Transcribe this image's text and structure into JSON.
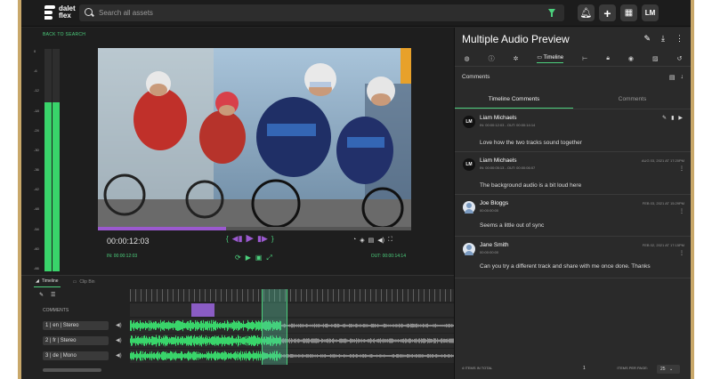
{
  "app": {
    "logo_text": "dalet flex",
    "search_placeholder": "Search all assets",
    "user_initials": "LM"
  },
  "player": {
    "back_label": "BACK TO SEARCH",
    "current_time": "00:00:12:03",
    "in_point": "IN: 00:00:12:03",
    "out_point": "OUT: 00:00:14:14",
    "progress_fraction": 0.41,
    "vu_scale": [
      "0",
      "-6",
      "-12",
      "-18",
      "-24",
      "-30",
      "-36",
      "-42",
      "-48",
      "-54",
      "-60",
      "-66"
    ],
    "vu_levels": [
      0.0,
      0.76,
      0.76
    ]
  },
  "timeline": {
    "tabs": [
      {
        "label": "Timeline",
        "active": true
      },
      {
        "label": "Clip Bin",
        "active": false
      }
    ],
    "comments_label": "COMMENTS",
    "tracks": [
      {
        "label": "1 | en | Stereo"
      },
      {
        "label": "2 | fr | Stereo"
      },
      {
        "label": "3 | de | Mono"
      }
    ]
  },
  "panel": {
    "title": "Multiple Audio Preview",
    "active_tab": "Timeline",
    "comments_header": "Comments",
    "sub_tabs": [
      {
        "label": "Timeline Comments",
        "active": true
      },
      {
        "label": "Comments",
        "active": false
      }
    ],
    "comments": [
      {
        "initials": "LM",
        "name": "Liam  Michaels",
        "inout": "IN: 00:00:12:03  -  OUT: 00:00:14:14",
        "date": "",
        "text": "Love how the two tracks sound together"
      },
      {
        "initials": "LM",
        "name": "Liam  Michaels",
        "inout": "IN: 00:00:05:13  -  OUT: 00:00:06:07",
        "date": "AUG 03, 2021 AT 17:20PM",
        "text": "The background audio is a bit loud here"
      },
      {
        "initials": "",
        "name": "Joe Bloggs",
        "inout": "00:00:00:00",
        "date": "FEB 03, 2021 AT 15:29PM",
        "text": "Seems a little out of sync"
      },
      {
        "initials": "",
        "name": "Jane Smith",
        "inout": "00:00:00:00",
        "date": "FEB 02, 2021 AT 17:15PM",
        "text": "Can you try a different track and share with me once done. Thanks"
      }
    ],
    "footer": {
      "count": "4 ITEMS IN TOTAL",
      "page": "1",
      "items_per_page_label": "ITEMS PER PAGE:",
      "items_per_page": "25"
    }
  },
  "colors": {
    "accent_green": "#4cd07d",
    "accent_purple": "#9b59d0",
    "waveform_green": "#39d46a",
    "waveform_grey": "#8a8a8a"
  }
}
